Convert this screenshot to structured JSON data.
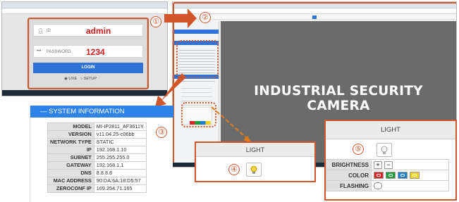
{
  "steps": [
    "①",
    "②",
    "③",
    "④",
    "⑤"
  ],
  "login": {
    "id_placeholder": "ID",
    "id_value": "admin",
    "password_placeholder": "PASSWORD",
    "password_value": "1234",
    "login_button": "LOGIN",
    "radio_live": "LIVE",
    "radio_setup": "SETUP"
  },
  "camera": {
    "overlay_text": "INDUSTRIAL SECURITY CAMERA"
  },
  "system_info": {
    "header": "SYSTEM INFORMATION",
    "toggle": "—",
    "rows": [
      {
        "key": "MODEL",
        "value": "MI-IP2811_AF3611Y"
      },
      {
        "key": "VERSION",
        "value": "v11.04.25-c06bb"
      },
      {
        "key": "NETWORK TYPE",
        "value": "STATIC"
      },
      {
        "key": "IP",
        "value": "192.168.1.10"
      },
      {
        "key": "SUBNET",
        "value": "255.255.255.0"
      },
      {
        "key": "GATEWAY",
        "value": "192.168.1.1"
      },
      {
        "key": "DNS",
        "value": "8.8.8.8"
      },
      {
        "key": "MAC ADDRESS",
        "value": "90:DA:6A:18:D5:57"
      },
      {
        "key": "ZEROCONF IP",
        "value": "169.254.71.165"
      }
    ]
  },
  "light_small": {
    "title": "LIGHT",
    "bulb_icon": "light-bulb-on-icon"
  },
  "light_large": {
    "title": "LIGHT",
    "bulb_icon": "light-bulb-off-icon",
    "brightness_label": "BRIGHTNESS",
    "brightness_plus": "+",
    "brightness_minus": "−",
    "color_label": "COLOR",
    "colors": [
      "#e02424",
      "#1e9e3a",
      "#1f7fd6",
      "#f2d21b"
    ],
    "flashing_label": "FLASHING"
  },
  "accent": "#d0552a"
}
